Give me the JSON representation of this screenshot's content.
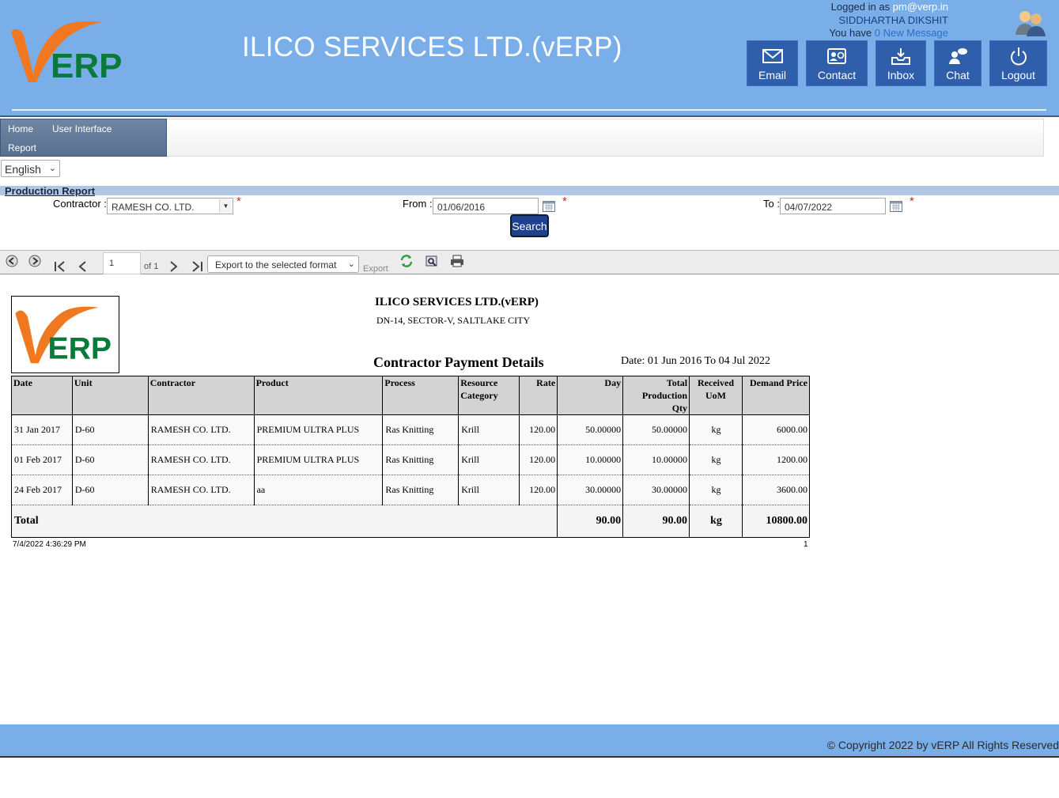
{
  "header": {
    "app_title": "ILICO SERVICES LTD.(vERP)",
    "logged_in_prefix": "Logged in as ",
    "logged_in_email": "pm@verp.in",
    "user_name": "SIDDHARTHA DIKSHIT",
    "msg_prefix": "You have ",
    "msg_link": "0 New Message",
    "buttons": [
      "Email",
      "Contact",
      "Inbox",
      "Chat",
      "Logout"
    ],
    "logo_text": "ERP",
    "logo_v": "v"
  },
  "menu": {
    "home": "Home",
    "user_interface": "User Interface",
    "report": "Report"
  },
  "language": {
    "selected": "English"
  },
  "report_form": {
    "title": "Production Report",
    "contractor_label": "Contractor :",
    "contractor_value": "RAMESH CO. LTD.",
    "from_label": "From :",
    "from_value": "01/06/2016",
    "to_label": "To :",
    "to_value": "04/07/2022",
    "required_mark": "*",
    "search_label": "Search"
  },
  "viewer_toolbar": {
    "page_value": "1",
    "page_of": "of 1",
    "export_select": "Export to the selected format",
    "export_label": "Export"
  },
  "report": {
    "company": "ILICO SERVICES LTD.(vERP)",
    "address": "DN-14, SECTOR-V, SALTLAKE CITY",
    "heading": "Contractor Payment Details",
    "date_range": "Date: 01 Jun 2016 To 04 Jul 2022",
    "columns": [
      "Date",
      "Unit",
      "Contractor",
      "Product",
      "Process",
      "Resource Category",
      "Rate",
      "Day",
      "Total Production Qty",
      "Received UoM",
      "Demand Price"
    ],
    "rows": [
      [
        "31 Jan 2017",
        "D-60",
        "RAMESH CO. LTD.",
        "PREMIUM ULTRA PLUS",
        "Ras Knitting",
        "Krill",
        "120.00",
        "50.00000",
        "50.00000",
        "kg",
        "6000.00"
      ],
      [
        "01 Feb 2017",
        "D-60",
        "RAMESH CO. LTD.",
        "PREMIUM ULTRA PLUS",
        "Ras Knitting",
        "Krill",
        "120.00",
        "10.00000",
        "10.00000",
        "kg",
        "1200.00"
      ],
      [
        "24 Feb 2017",
        "D-60",
        "RAMESH CO. LTD.",
        "aa",
        "Ras Knitting",
        "Krill",
        "120.00",
        "30.00000",
        "30.00000",
        "kg",
        "3600.00"
      ]
    ],
    "total": {
      "label": "Total",
      "day": "90.00",
      "qty": "90.00",
      "uom": "kg",
      "price": "10800.00"
    },
    "timestamp": "7/4/2022 4:36:29 PM",
    "page_number": "1"
  },
  "footer": {
    "copyright": "© Copyright 2022 by vERP All Rights Reserved"
  },
  "colors": {
    "header_bg": "#7aaee8",
    "nav_button": "#2f5eab",
    "logo_orange": "#f07820",
    "logo_green": "#0a7a3a"
  }
}
